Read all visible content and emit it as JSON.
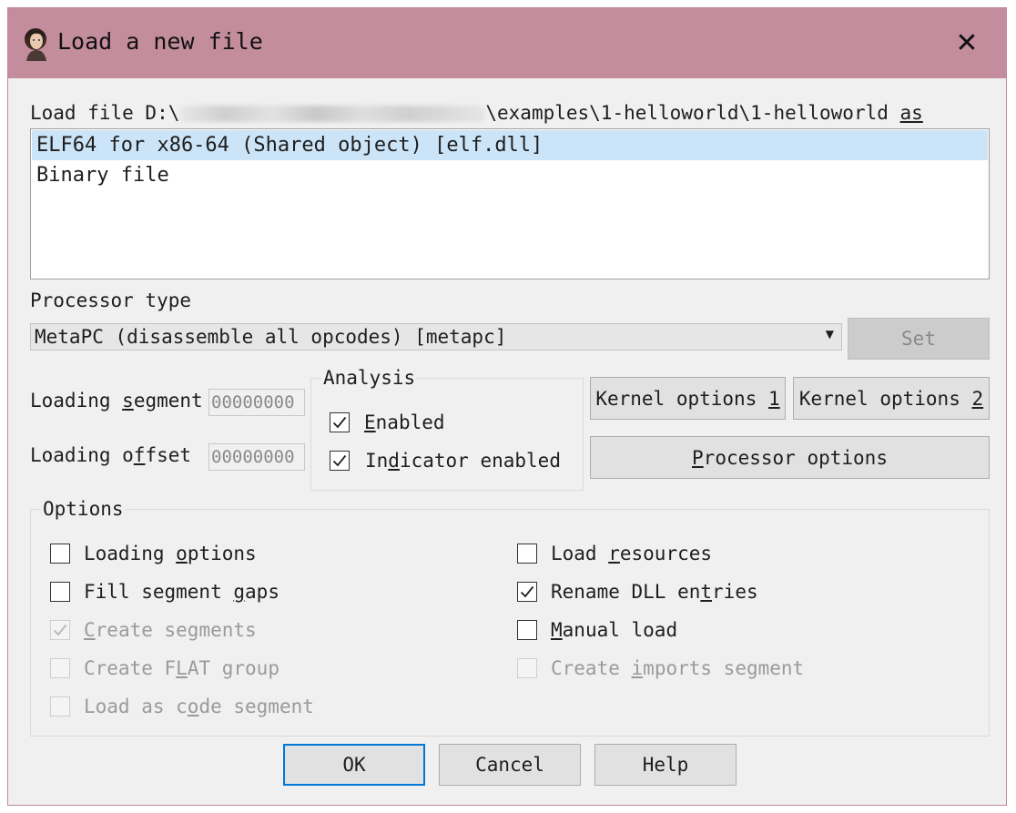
{
  "window": {
    "title": "Load a new file",
    "close_glyph": "✕",
    "icon": "ada-portrait-icon"
  },
  "load_file": {
    "prefix": "Load file D:\\",
    "suffix": "\\examples\\1-helloworld\\1-helloworld ",
    "as_label": "as"
  },
  "file_types": [
    {
      "label": "ELF64 for x86-64 (Shared object) [elf.dll]",
      "selected": true
    },
    {
      "label": "Binary file",
      "selected": false
    }
  ],
  "processor": {
    "label": "Processor type",
    "selected": "MetaPC (disassemble all opcodes) [metapc]",
    "set_label": "Set"
  },
  "loading_segment": {
    "label_pre": "Loading ",
    "label_u": "s",
    "label_post": "egment",
    "value": "00000000"
  },
  "loading_offset": {
    "label_pre": "Loading o",
    "label_u": "f",
    "label_post": "fset",
    "value": "00000000"
  },
  "analysis": {
    "title": "Analysis",
    "enabled": {
      "pre": "",
      "u": "E",
      "post": "nabled",
      "checked": true
    },
    "indicator": {
      "pre": "In",
      "u": "d",
      "post": "icator enabled",
      "checked": true
    }
  },
  "kernel_options_1": {
    "pre": "Kernel options ",
    "u": "1"
  },
  "kernel_options_2": {
    "pre": "Kernel options ",
    "u": "2"
  },
  "processor_options": {
    "pre": "",
    "u": "P",
    "post": "rocessor options"
  },
  "options": {
    "title": "Options",
    "loading_options": {
      "pre": "Loading ",
      "u": "o",
      "post": "ptions",
      "checked": false,
      "enabled": true
    },
    "fill_gaps": {
      "pre": "Fill segment ",
      "u": "g",
      "post": "aps",
      "checked": false,
      "enabled": true
    },
    "create_segments": {
      "pre": "",
      "u": "C",
      "post": "reate segments",
      "checked": true,
      "enabled": false
    },
    "create_flat": {
      "pre": "Create F",
      "u": "L",
      "post": "AT group",
      "checked": false,
      "enabled": false
    },
    "load_code": {
      "pre": "Load as c",
      "u": "o",
      "post": "de segment",
      "checked": false,
      "enabled": false
    },
    "load_resources": {
      "pre": "Load ",
      "u": "r",
      "post": "esources",
      "checked": false,
      "enabled": true
    },
    "rename_dll": {
      "pre": "Rename DLL en",
      "u": "t",
      "post": "ries",
      "checked": true,
      "enabled": true
    },
    "manual_load": {
      "pre": "",
      "u": "M",
      "post": "anual load",
      "checked": false,
      "enabled": true
    },
    "create_imports": {
      "pre": "Create ",
      "u": "i",
      "post": "mports segment",
      "checked": false,
      "enabled": false
    }
  },
  "buttons": {
    "ok": "OK",
    "cancel": "Cancel",
    "help": "Help"
  }
}
